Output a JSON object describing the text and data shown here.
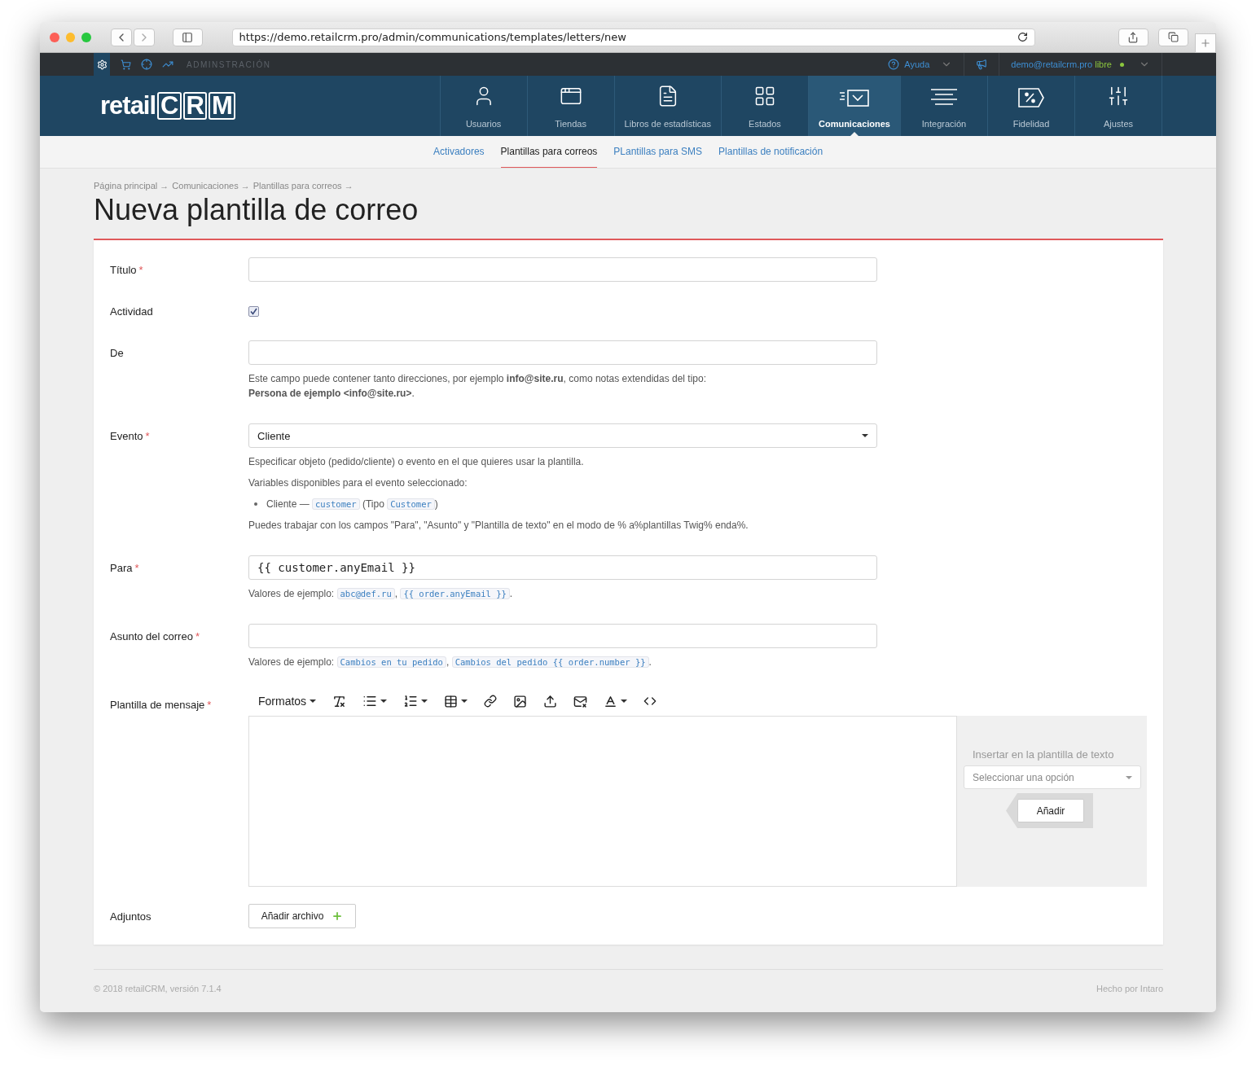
{
  "browser": {
    "url": "https://demo.retailcrm.pro/admin/communications/templates/letters/new"
  },
  "admin_bar": {
    "section": "ADMINSTRACIÓN",
    "help": "Ayuda",
    "user": "demo@retailcrm.pro",
    "plan": "libre"
  },
  "logo": {
    "text": "retail",
    "letters": [
      "C",
      "R",
      "M"
    ]
  },
  "nav": [
    {
      "label": "Usuarios",
      "selected": false
    },
    {
      "label": "Tiendas",
      "selected": false
    },
    {
      "label": "Libros de estadísticas",
      "selected": false
    },
    {
      "label": "Estados",
      "selected": false
    },
    {
      "label": "Comunicaciones",
      "selected": true
    },
    {
      "label": "Integración",
      "selected": false
    },
    {
      "label": "Fidelidad",
      "selected": false
    },
    {
      "label": "Ajustes",
      "selected": false
    }
  ],
  "subnav": [
    {
      "label": "Activadores",
      "selected": false
    },
    {
      "label": "Plantillas para correos",
      "selected": true
    },
    {
      "label": "PLantillas para SMS",
      "selected": false
    },
    {
      "label": "Plantillas de notificación",
      "selected": false
    }
  ],
  "breadcrumb": {
    "separator": "→",
    "items": [
      "Página principal",
      "Comunicaciones",
      "Plantillas para correos"
    ]
  },
  "title": "Nueva plantilla de correo",
  "form": {
    "required_mark": "*",
    "fields": [
      {
        "kind": "text",
        "label": "Título",
        "required": true
      },
      {
        "kind": "checkbox",
        "label": "Actividad",
        "required": false,
        "checked": true
      },
      {
        "kind": "text",
        "label": "De",
        "required": false,
        "help": [
          "Este campo puede contener tanto direcciones, por ejemplo **info@site.ru**, como notas extendidas del tipo:",
          "**Persona de ejemplo <info@site.ru>**."
        ]
      },
      {
        "kind": "select",
        "label": "Evento",
        "required": true,
        "value": "Cliente",
        "notes": [
          "Especificar objeto (pedido/cliente) o evento en el que quieres usar la plantilla.",
          "Variables disponibles para el evento seleccionado:"
        ],
        "variables": [
          {
            "name": "Cliente —",
            "code": "customer",
            "type_prefix": "(Tipo",
            "type": "Customer",
            "suffix": ")"
          }
        ],
        "footnote": "Puedes trabajar con los campos \"Para\", \"Asunto\" y \"Plantilla de texto\" en el modo de % a%plantillas Twig% enda%."
      },
      {
        "kind": "text",
        "label": "Para",
        "required": true,
        "value": "{{ customer.anyEmail }}",
        "examples": {
          "prefix": "Valores de ejemplo:",
          "items": [
            "abc@def.ru",
            "{{ order.anyEmail }}"
          ],
          "separator": ",",
          "end": "."
        }
      },
      {
        "kind": "text",
        "label": "Asunto del correo",
        "required": true,
        "examples": {
          "prefix": "Valores de ejemplo:",
          "items": [
            "Cambios en tu pedido",
            "Cambios del pedido {{ order.number }}"
          ],
          "separator": ",",
          "end": "."
        }
      },
      {
        "kind": "editor",
        "label": "Plantilla de mensaje",
        "required": true,
        "format_menu": "Formatos",
        "panel": {
          "label": "Insertar en la plantilla de texto",
          "placeholder": "Seleccionar una opción",
          "button": "Añadir"
        }
      },
      {
        "kind": "file",
        "label": "Adjuntos",
        "required": false,
        "button": "Añadir archivo"
      }
    ]
  },
  "footer": {
    "copyright": "© 2018 retailCRM, versión 7.1.4",
    "credit": "Hecho por Intaro"
  }
}
